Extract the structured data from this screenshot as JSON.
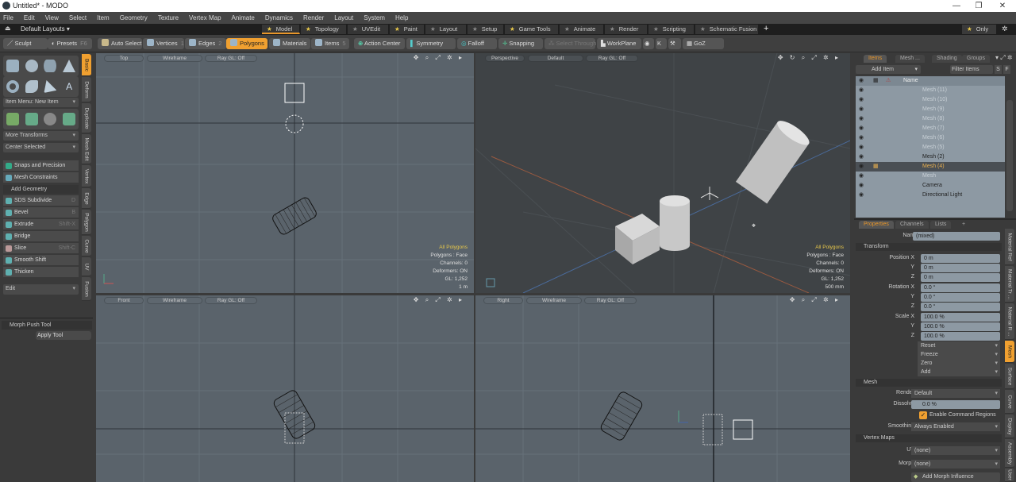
{
  "window": {
    "title": "Untitled* - MODO",
    "minimize": "—",
    "maximize": "❐",
    "close": "✕"
  },
  "menu": [
    "File",
    "Edit",
    "View",
    "Select",
    "Item",
    "Geometry",
    "Texture",
    "Vertex Map",
    "Animate",
    "Dynamics",
    "Render",
    "Layout",
    "System",
    "Help"
  ],
  "layouts": {
    "default_layouts": "Default Layouts ▾",
    "tabs": [
      {
        "label": "Model",
        "fav": true,
        "active": true
      },
      {
        "label": "Topology",
        "fav": true
      },
      {
        "label": "UVEdit",
        "fav": false
      },
      {
        "label": "Paint",
        "fav": true
      },
      {
        "label": "Layout",
        "fav": false
      },
      {
        "label": "Setup",
        "fav": false
      },
      {
        "label": "Game Tools",
        "fav": true
      },
      {
        "label": "Animate",
        "fav": false
      },
      {
        "label": "Render",
        "fav": false
      },
      {
        "label": "Scripting",
        "fav": false
      },
      {
        "label": "Schematic Fusion",
        "fav": false
      }
    ],
    "add": "+",
    "only": "Only"
  },
  "toolbar": {
    "sculpt": "Sculpt",
    "presets": "Presets",
    "presets_key": "F6",
    "auto_select": "Auto Select",
    "vertices": "Vertices",
    "vertices_key": "1",
    "edges": "Edges",
    "edges_key": "2",
    "polygons": "Polygons",
    "materials": "Materials",
    "items": "Items",
    "items_key": "5",
    "action_center": "Action Center",
    "symmetry": "Symmetry",
    "falloff": "Falloff",
    "snapping": "Snapping",
    "select_through": "Select Through",
    "workplane": "WorkPlane",
    "goz": "GoZ"
  },
  "left": {
    "item_menu": "Item Menu: New Item",
    "more_transforms": "More Transforms",
    "center_selected": "Center Selected",
    "snaps": "Snaps and Precision",
    "mesh_constraints": "Mesh Constraints",
    "add_geometry": "Add Geometry",
    "tools": [
      {
        "label": "SDS Subdivide",
        "key": "D"
      },
      {
        "label": "Bevel",
        "key": "B"
      },
      {
        "label": "Extrude",
        "key": "Shift-X"
      },
      {
        "label": "Bridge",
        "key": ""
      },
      {
        "label": "Slice",
        "key": "Shift-C"
      },
      {
        "label": "Smooth Shift",
        "key": ""
      },
      {
        "label": "Thicken",
        "key": ""
      }
    ],
    "edit": "Edit",
    "morph_push": "Morph Push Tool",
    "apply_tool": "Apply Tool",
    "vtabs": [
      "Basic",
      "Deform",
      "Duplicate",
      "Mesh Edit",
      "Vertex",
      "Edge",
      "Polygon",
      "Curve",
      "UV",
      "Fusion"
    ]
  },
  "viewports": {
    "top": {
      "view": "Top",
      "shade": "Wireframe",
      "ray": "Ray GL: Off",
      "hud": [
        "All Polygons",
        "Polygons : Face",
        "Channels: 0",
        "Deformers: ON",
        "GL: 1,252",
        "1 m"
      ]
    },
    "persp": {
      "view": "Perspective",
      "shade": "Default",
      "ray": "Ray GL: Off",
      "hud": [
        "All Polygons",
        "Polygons : Face",
        "Channels: 0",
        "Deformers: ON",
        "GL: 1,252",
        "500 mm"
      ]
    },
    "front": {
      "view": "Front",
      "shade": "Wireframe",
      "ray": "Ray GL: Off"
    },
    "right": {
      "view": "Right",
      "shade": "Wireframe",
      "ray": "Ray GL: Off"
    },
    "icons": "✥ ⌕ ⤢ ✲ ▸",
    "persp_icons": "✥ ↻ ⌕ ⤢ ✲ ▸"
  },
  "items_panel": {
    "tabs": [
      "Items",
      "Mesh ...",
      "Shading",
      "Groups"
    ],
    "add_item": "Add Item",
    "filter": "Filter Items",
    "s": "S",
    "f": "F",
    "name_col": "Name",
    "rows": [
      {
        "name": "Mesh (11)",
        "state": "dim"
      },
      {
        "name": "Mesh (10)",
        "state": "dim"
      },
      {
        "name": "Mesh (9)",
        "state": "dim"
      },
      {
        "name": "Mesh (8)",
        "state": "dim"
      },
      {
        "name": "Mesh (7)",
        "state": "dim"
      },
      {
        "name": "Mesh (6)",
        "state": "dim"
      },
      {
        "name": "Mesh (5)",
        "state": "dim"
      },
      {
        "name": "Mesh (2)",
        "state": "dark"
      },
      {
        "name": "Mesh (4)",
        "state": "sel"
      },
      {
        "name": "Mesh",
        "state": "dim"
      },
      {
        "name": "Camera",
        "state": "dark"
      },
      {
        "name": "Directional Light",
        "state": "dark"
      }
    ]
  },
  "properties": {
    "tabs": [
      "Properties",
      "Channels",
      "Lists",
      "+"
    ],
    "name_label": "Name",
    "name_value": "(mixed)",
    "transform": "Transform",
    "position": [
      {
        "l": "Position X",
        "v": "0 m"
      },
      {
        "l": "Y",
        "v": "0 m"
      },
      {
        "l": "Z",
        "v": "0 m"
      }
    ],
    "rotation": [
      {
        "l": "Rotation X",
        "v": "0.0 °"
      },
      {
        "l": "Y",
        "v": "0.0 °"
      },
      {
        "l": "Z",
        "v": "0.0 °"
      }
    ],
    "scale": [
      {
        "l": "Scale X",
        "v": "100.0 %"
      },
      {
        "l": "Y",
        "v": "100.0 %"
      },
      {
        "l": "Z",
        "v": "100.0 %"
      }
    ],
    "actions": [
      "Reset",
      "Freeze",
      "Zero",
      "Add"
    ],
    "mesh": "Mesh",
    "render_label": "Render",
    "render_value": "Default",
    "dissolve_label": "Dissolve",
    "dissolve_value": "0.0 %",
    "enable_cmd": "Enable Command Regions",
    "smoothing_label": "Smoothing",
    "smoothing_value": "Always Enabled",
    "vertex_maps": "Vertex Maps",
    "uv_label": "UV",
    "uv_value": "(none)",
    "morph_label": "Morph",
    "morph_value": "(none)",
    "add_morph": "Add Morph Influence",
    "vtabs": [
      "Material Ref",
      "Material Tr ...",
      "Material R ...",
      "Mesh",
      "Surface",
      "Curve",
      "Display",
      "Assembly",
      "User"
    ]
  }
}
